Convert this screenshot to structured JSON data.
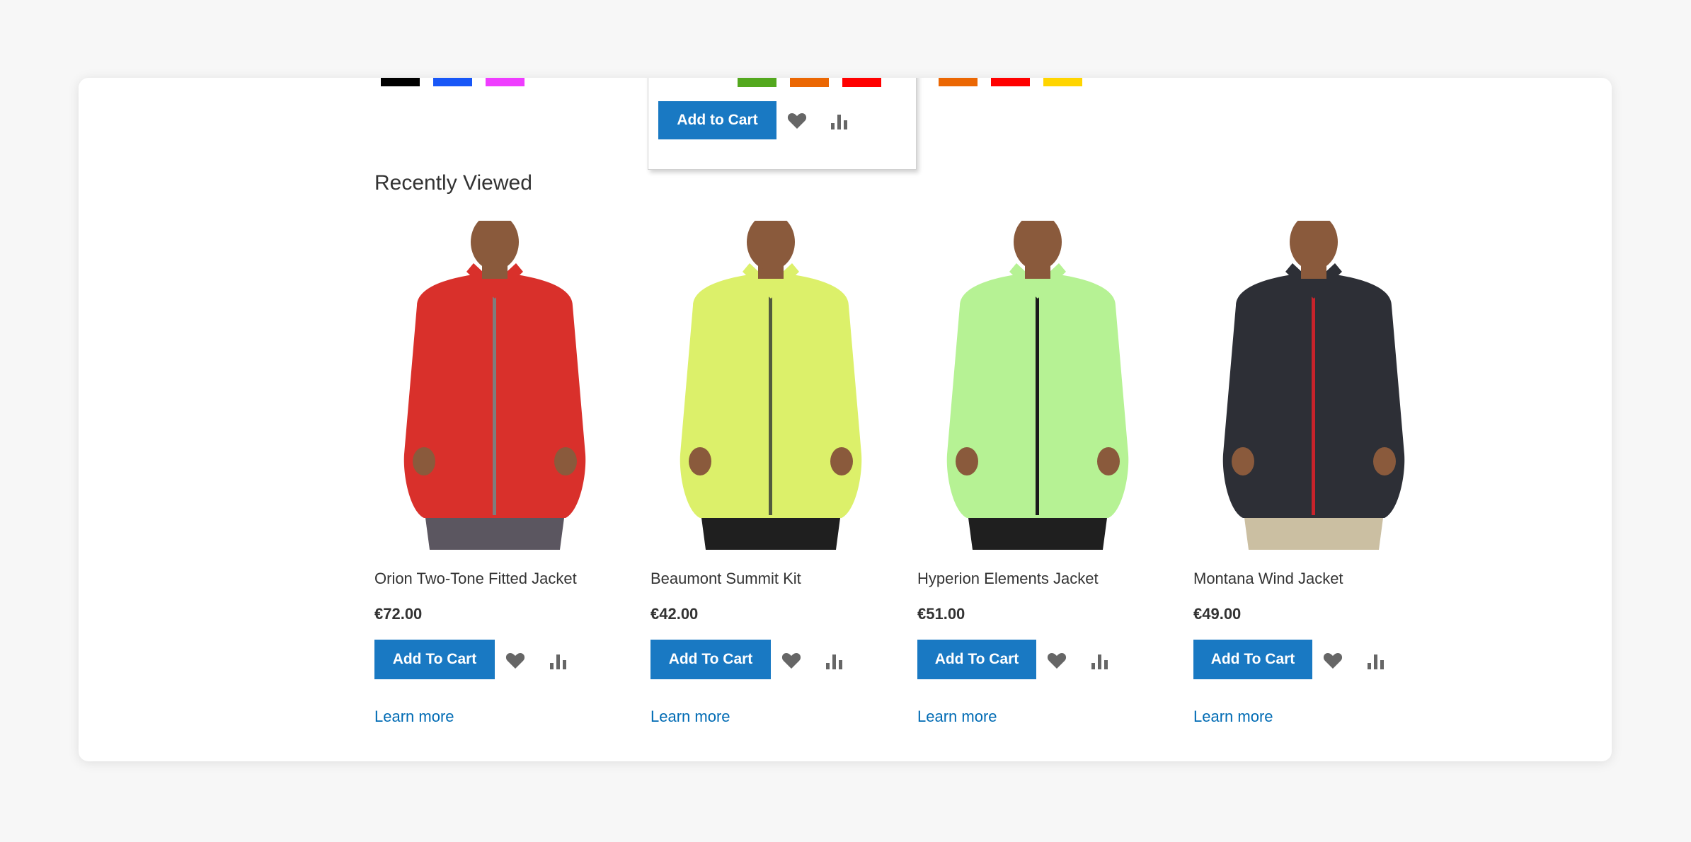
{
  "swatches": {
    "group1": [
      "#000000",
      "#1857f7",
      "#ef3dff"
    ],
    "group2": [
      "#53a81e",
      "#eb6703",
      "#ff0000"
    ],
    "group3": [
      "#eb6703",
      "#ff0000",
      "#ffd500"
    ]
  },
  "popup": {
    "add_to_cart_label": "Add to Cart",
    "wishlist_icon": "heart-icon",
    "compare_icon": "bar-chart-icon"
  },
  "recently_viewed": {
    "title": "Recently Viewed",
    "products": [
      {
        "name": "Orion Two-Tone Fitted Jacket",
        "price": "€72.00",
        "add_to_cart": "Add To Cart",
        "learn_more": "Learn more",
        "jacket_color": "#d9302b",
        "accent": "#7d7d7d",
        "pants": "#5b5660"
      },
      {
        "name": "Beaumont Summit Kit",
        "price": "€42.00",
        "add_to_cart": "Add To Cart",
        "learn_more": "Learn more",
        "jacket_color": "#dcf06a",
        "accent": "#525a3e",
        "pants": "#1f1f1f"
      },
      {
        "name": "Hyperion Elements Jacket",
        "price": "€51.00",
        "add_to_cart": "Add To Cart",
        "learn_more": "Learn more",
        "jacket_color": "#b6f294",
        "accent": "#1a1a1a",
        "pants": "#1f1f1f"
      },
      {
        "name": "Montana Wind Jacket",
        "price": "€49.00",
        "add_to_cart": "Add To Cart",
        "learn_more": "Learn more",
        "jacket_color": "#2d2f36",
        "accent": "#c8232b",
        "pants": "#cbbfa2"
      }
    ]
  },
  "colors": {
    "primary_button": "#1979c3",
    "link": "#006bb4",
    "icon": "#666666",
    "skin": "#8a5a3c"
  }
}
